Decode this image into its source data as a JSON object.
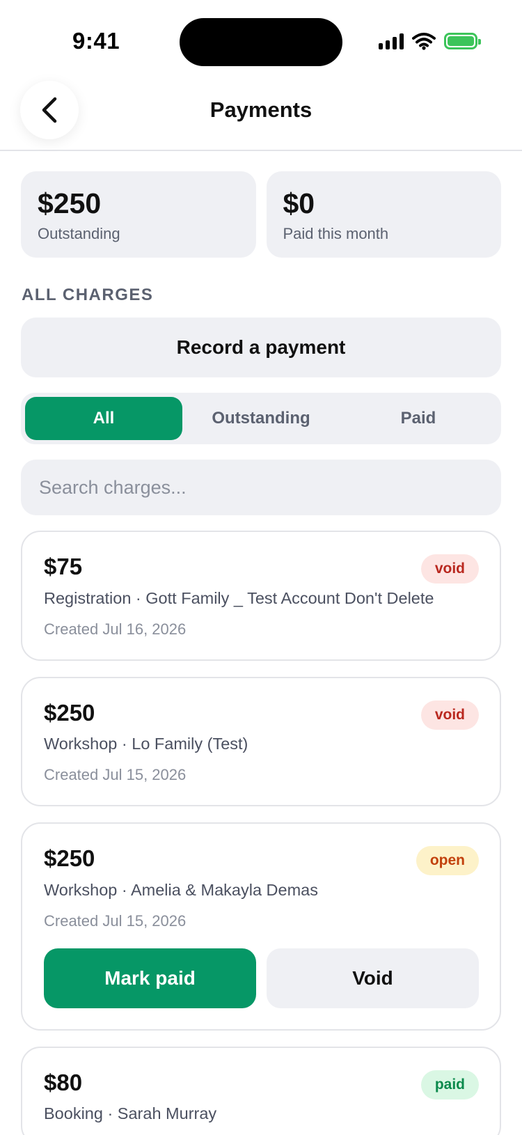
{
  "status_bar": {
    "time": "9:41"
  },
  "header": {
    "title": "Payments"
  },
  "summary": [
    {
      "amount": "$250",
      "label": "Outstanding"
    },
    {
      "amount": "$0",
      "label": "Paid this month"
    }
  ],
  "section_label": "ALL CHARGES",
  "record_button": "Record a payment",
  "filters": {
    "tabs": [
      "All",
      "Outstanding",
      "Paid"
    ],
    "active": "All"
  },
  "search": {
    "placeholder": "Search charges..."
  },
  "charges": [
    {
      "amount": "$75",
      "status": "void",
      "description": "Registration · Gott Family _ Test Account Don't Delete",
      "created": "Created Jul 16, 2026"
    },
    {
      "amount": "$250",
      "status": "void",
      "description": "Workshop · Lo Family (Test)",
      "created": "Created Jul 15, 2026"
    },
    {
      "amount": "$250",
      "status": "open",
      "description": "Workshop · Amelia & Makayla Demas",
      "created": "Created Jul 15, 2026",
      "actions": {
        "mark_paid": "Mark paid",
        "void": "Void"
      }
    },
    {
      "amount": "$80",
      "status": "paid",
      "description": "Booking · Sarah Murray",
      "created": ""
    }
  ],
  "colors": {
    "accent": "#069766",
    "surface": "#eff0f4",
    "void_text": "#b9281f",
    "open_text": "#c2410c",
    "paid_text": "#0b8a4c"
  },
  "icons": {
    "back": "chevron-left-icon"
  }
}
